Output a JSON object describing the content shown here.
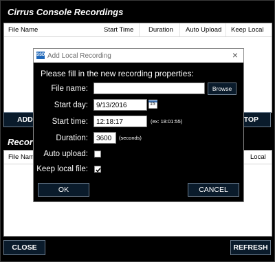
{
  "app": {
    "title": "Cirrus Console Recordings"
  },
  "recordings_table": {
    "columns": [
      "File Name",
      "Start Time",
      "Duration",
      "Auto Upload",
      "Keep Local"
    ]
  },
  "buttons": {
    "add": "ADD",
    "stop": "STOP",
    "close": "CLOSE",
    "refresh": "REFRESH"
  },
  "local_section": {
    "title": "Recordings",
    "title_visible": "Record",
    "columns": [
      "File Name",
      "Keep Local"
    ],
    "visible_right_column": "Local"
  },
  "dialog": {
    "title": "Add Local Recording",
    "app_icon_text": "SSD",
    "prompt": "Please fill in the new recording properties:",
    "file_name": {
      "label": "File name:",
      "value": "",
      "browse": "Browse"
    },
    "start_day": {
      "label": "Start day:",
      "value": "9/13/2016",
      "calendar_day": "15"
    },
    "start_time": {
      "label": "Start time:",
      "value": "12:18:17",
      "hint": "(ex: 18:01:55)"
    },
    "duration": {
      "label": "Duration:",
      "value": "3600",
      "hint": "(seconds)"
    },
    "auto_upload": {
      "label": "Auto upload:",
      "checked": false
    },
    "keep_local": {
      "label": "Keep local file:",
      "checked": true
    },
    "ok": "OK",
    "cancel": "CANCEL"
  }
}
